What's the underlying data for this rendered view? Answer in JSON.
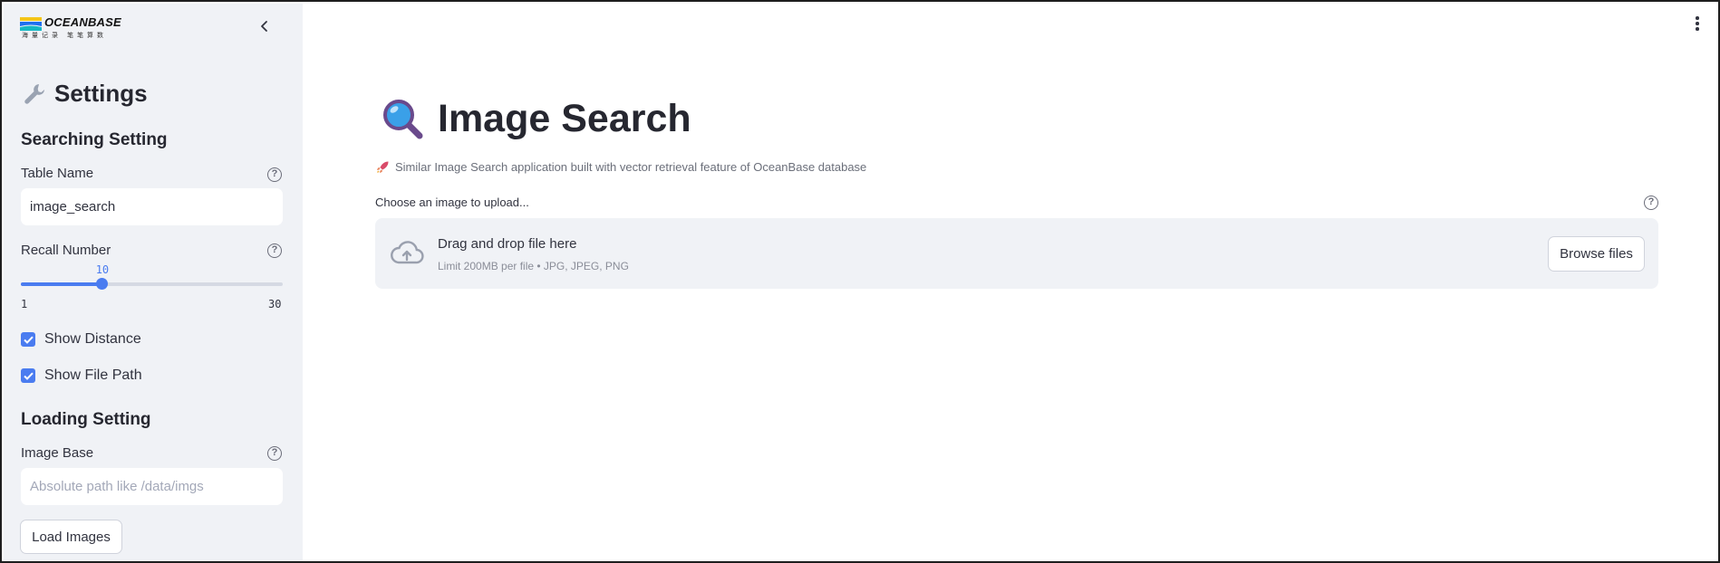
{
  "brand": {
    "name": "OCEANBASE",
    "tagline": "海量记录 笔笔算数",
    "colors": {
      "blue": "#1e6ff0",
      "yellow": "#f5c518",
      "teal": "#14b8c4"
    }
  },
  "sidebar": {
    "title": "Settings",
    "title_icon": "wrench-icon",
    "searching_section": "Searching Setting",
    "table_name": {
      "label": "Table Name",
      "value": "image_search"
    },
    "recall": {
      "label": "Recall Number",
      "value": 10,
      "value_label": "10",
      "min": 1,
      "max": 30,
      "min_label": "1",
      "max_label": "30"
    },
    "show_distance": {
      "label": "Show Distance",
      "checked": true
    },
    "show_file_path": {
      "label": "Show File Path",
      "checked": true
    },
    "loading_section": "Loading Setting",
    "image_base": {
      "label": "Image Base",
      "value": "",
      "placeholder": "Absolute path like /data/imgs"
    },
    "load_button": "Load Images"
  },
  "main": {
    "title": "Image Search",
    "title_icon": "magnifier-icon",
    "subtitle": "Similar Image Search application built with vector retrieval feature of OceanBase database",
    "subtitle_icon": "rocket-icon",
    "uploader": {
      "label": "Choose an image to upload...",
      "drop_text": "Drag and drop file here",
      "limit_text": "Limit 200MB per file • JPG, JPEG, PNG",
      "browse_button": "Browse files"
    }
  },
  "accent_color": "#4a7cf0"
}
